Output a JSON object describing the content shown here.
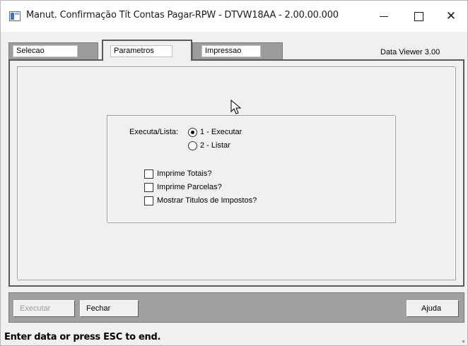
{
  "window": {
    "title": "Manut. Confirmação Tít Contas Pagar-RPW - DTVW18AA - 2.00.00.000",
    "minimize_glyph": "",
    "maximize_glyph": "",
    "close_glyph": "✕"
  },
  "tabs": [
    {
      "label": "Selecao"
    },
    {
      "label": "Parametros"
    },
    {
      "label": "Impressao"
    }
  ],
  "active_tab": "Parametros",
  "data_viewer": "Data Viewer 3.00",
  "parametros": {
    "executa_lista_label": "Executa/Lista:",
    "radio_options": [
      {
        "label": "1 - Executar",
        "checked": true
      },
      {
        "label": "2 - Listar",
        "checked": false
      }
    ],
    "checkboxes": [
      {
        "label": "Imprime Totais?",
        "checked": false
      },
      {
        "label": "Imprime Parcelas?",
        "checked": false
      },
      {
        "label": "Mostrar Titulos de Impostos?",
        "checked": false
      }
    ]
  },
  "buttons": {
    "executar": "Executar",
    "fechar": "Fechar",
    "ajuda": "Ajuda"
  },
  "status": {
    "text": "Enter data or press ESC to end."
  },
  "icons": {
    "app": "app-window-icon",
    "cursor": "mouse-pointer-icon"
  }
}
